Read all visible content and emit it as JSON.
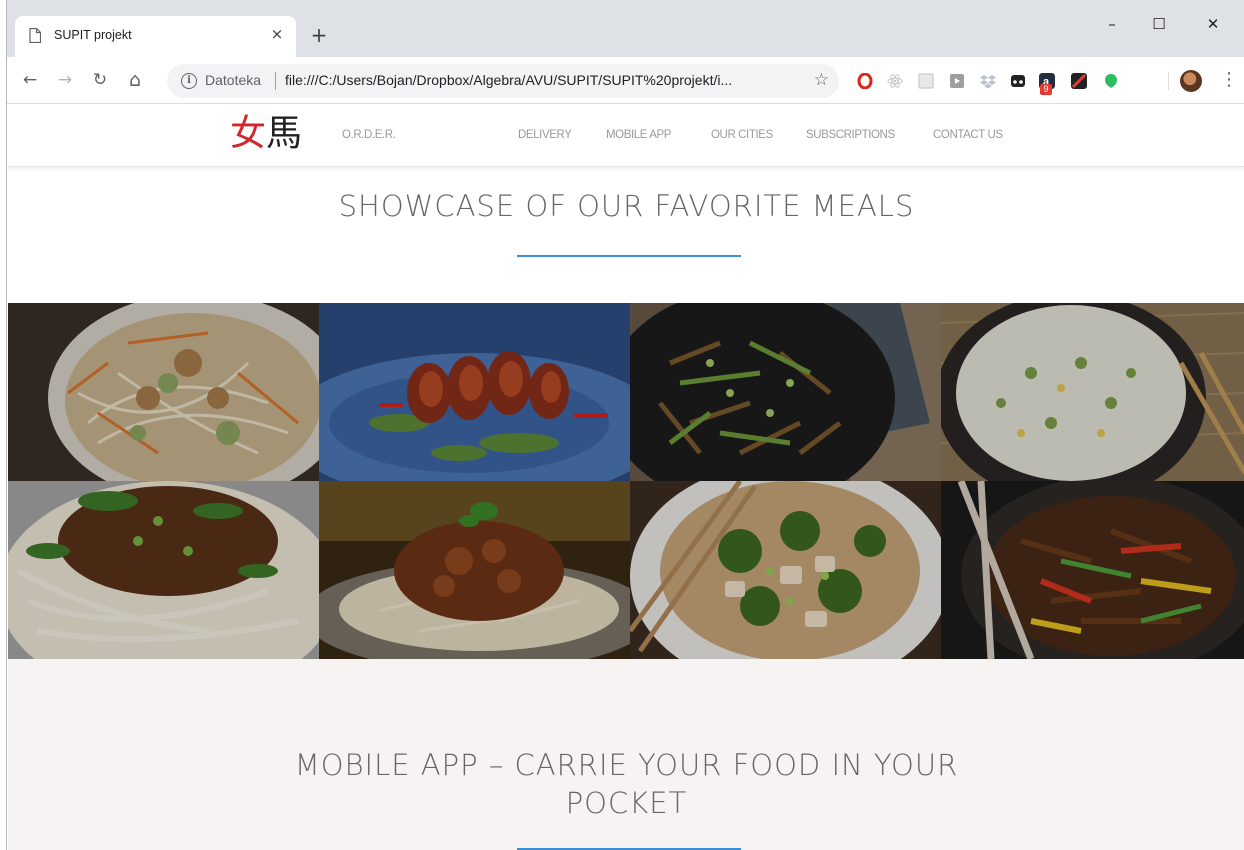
{
  "browser": {
    "tab_title": "SUPIT projekt",
    "tab_close": "×",
    "new_tab": "+",
    "window_controls": {
      "minimize": "–",
      "maximize": "☐",
      "close": "✕"
    },
    "nav": {
      "back": "←",
      "forward": "→",
      "reload": "↻",
      "home": "⌂"
    },
    "security_chip": "Datoteka",
    "url": "file:///C:/Users/Bojan/Dropbox/Algebra/AVU/SUPIT/SUPIT%20projekt/i...",
    "bookmark_star": "☆",
    "extension_badge": "9",
    "menu": "⋮"
  },
  "site": {
    "logo": {
      "char1": "女",
      "char2": "馬"
    },
    "nav": [
      "O.R.D.E.R.",
      "DELIVERY",
      "MOBILE APP",
      "OUR CITIES",
      "SUBSCRIPTIONS",
      "CONTACT US"
    ],
    "showcase": {
      "title": "SHOWCASE OF OUR FAVORITE MEALS",
      "meals": [
        {
          "name": "noodle-stir-fry"
        },
        {
          "name": "glazed-shrimp"
        },
        {
          "name": "pork-and-celery-stir-fry"
        },
        {
          "name": "fried-rice"
        },
        {
          "name": "minced-pork-noodles"
        },
        {
          "name": "braised-beef-on-noodles"
        },
        {
          "name": "chicken-broccoli-noodles"
        },
        {
          "name": "pepper-beef-stir-fry"
        }
      ]
    },
    "mobile_app": {
      "title_line1": "MOBILE APP – CARRIE YOUR FOOD IN YOUR",
      "title_line2": "POCKET"
    }
  },
  "colors": {
    "accent_line": "#3a8fd6",
    "logo_red": "#d3262b",
    "app_section_bg": "#f8f3f3"
  }
}
